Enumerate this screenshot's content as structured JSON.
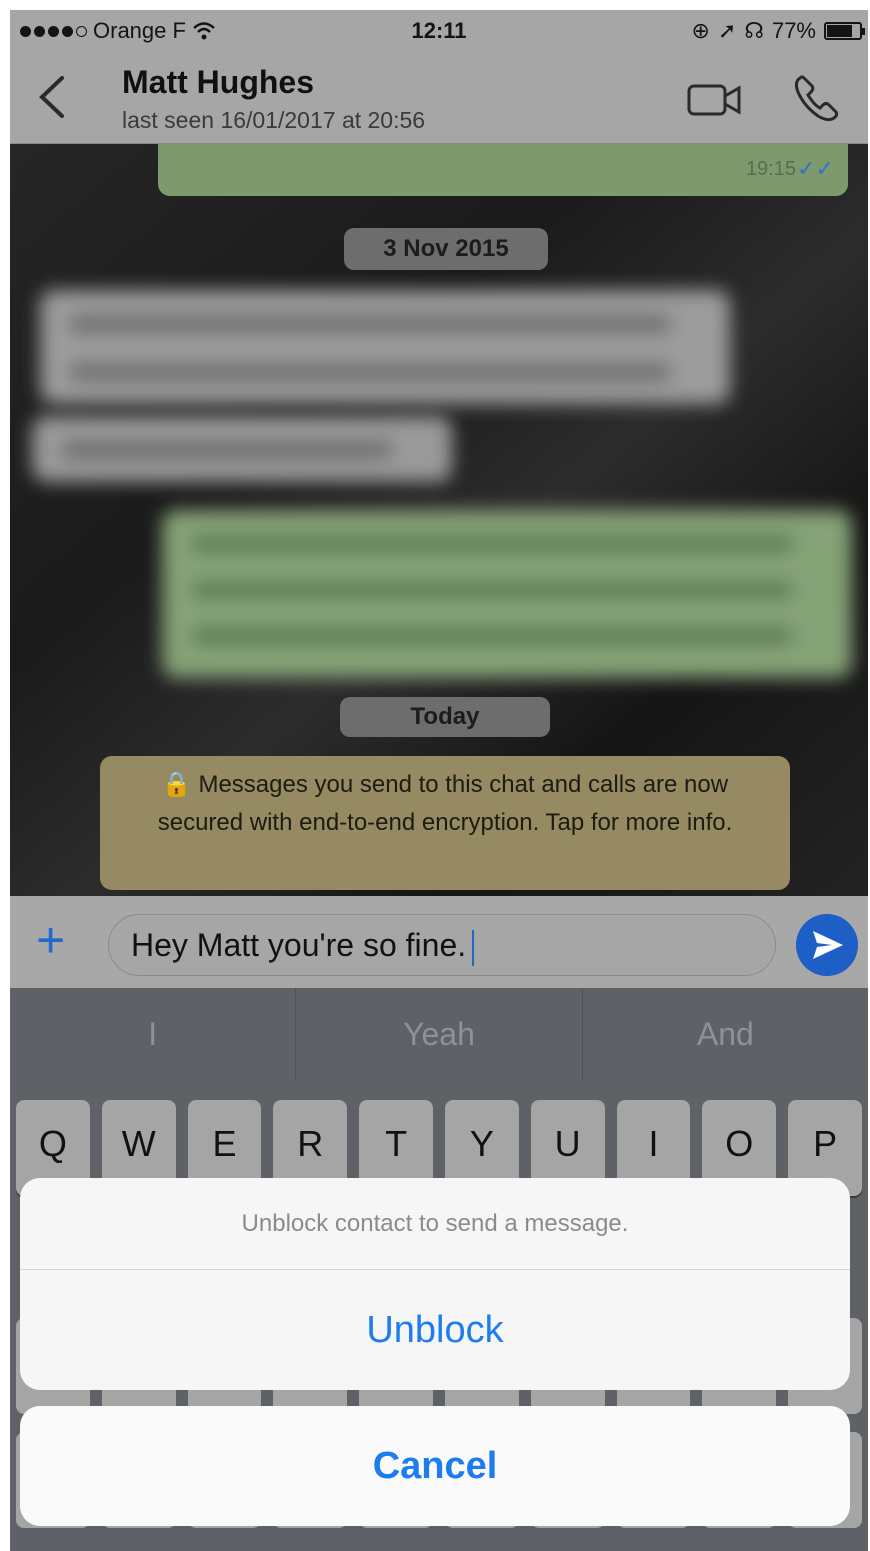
{
  "status_bar": {
    "carrier": "Orange F",
    "time": "12:11",
    "battery": "77%"
  },
  "header": {
    "contact_name": "Matt Hughes",
    "last_seen": "last seen 16/01/2017 at 20:56"
  },
  "chat": {
    "sent_time": "19:15",
    "date_divider_1": "3 Nov 2015",
    "date_divider_2": "Today",
    "encryption_notice": "🔒 Messages you send to this chat and calls are now secured with end-to-end encryption. Tap for more info."
  },
  "input": {
    "text": "Hey Matt you're so fine."
  },
  "keyboard": {
    "predictions": [
      "I",
      "Yeah",
      "And"
    ],
    "top_row": [
      "Q",
      "W",
      "E",
      "R",
      "T",
      "Y",
      "U",
      "I",
      "O",
      "P"
    ]
  },
  "action_sheet": {
    "message": "Unblock contact to send a message.",
    "unblock_label": "Unblock",
    "cancel_label": "Cancel"
  },
  "colors": {
    "accent": "#1c7cf0",
    "sent_bubble": "#7e9a6d",
    "notice_bg": "#958a62"
  }
}
